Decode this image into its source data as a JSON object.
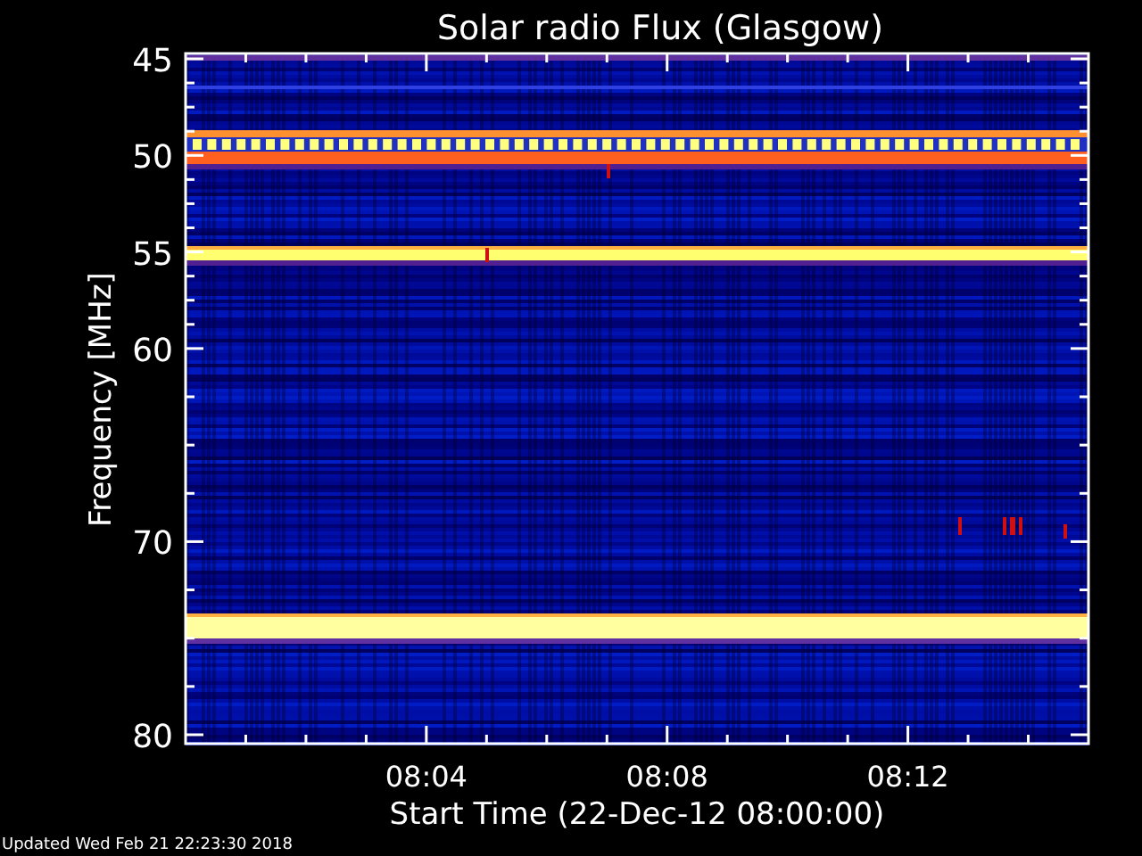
{
  "title": "Solar radio Flux (Glasgow)",
  "y_axis": {
    "label": "Frequency [MHz]",
    "ticks": [
      "45",
      "50",
      "55",
      "60",
      "70",
      "80"
    ]
  },
  "x_axis": {
    "label": "Start Time (22-Dec-12 08:00:00)",
    "ticks": [
      "08:04",
      "08:08",
      "08:12"
    ]
  },
  "footer": "Updated Wed Feb 21 22:23:30 2018"
}
